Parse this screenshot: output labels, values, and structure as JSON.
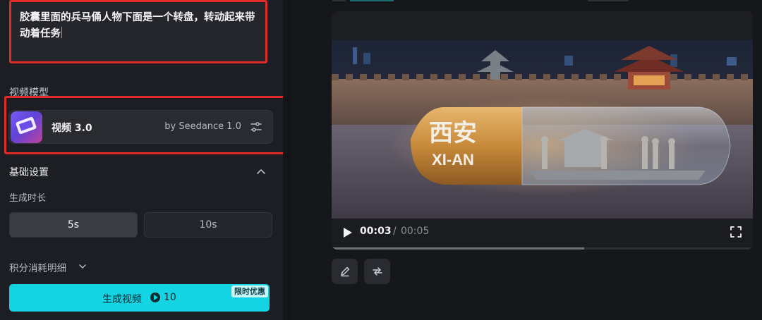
{
  "prompt": {
    "text": "胶囊里面的兵马俑人物下面是一个转盘，转动起来带动着任务"
  },
  "model": {
    "section_label": "视频模型",
    "name": "视频 3.0",
    "provider": "by Seedance 1.0"
  },
  "basic_settings": {
    "title": "基础设置",
    "duration_label": "生成时长",
    "options": [
      "5s",
      "10s"
    ],
    "selected": "5s"
  },
  "credits": {
    "label": "积分消耗明细"
  },
  "generate": {
    "label": "生成视频",
    "cost": "10",
    "badge": "限时优惠"
  },
  "video": {
    "capsule_text_cn": "西安",
    "capsule_text_en": "XI-AN",
    "current_time": "00:03",
    "separator": "/",
    "total_time": "00:05",
    "progress": 0.6
  },
  "icons": {
    "settings": "sliders-icon",
    "collapse": "chevron-up-icon",
    "expand": "chevron-down-icon",
    "play": "play-icon",
    "fullscreen": "fullscreen-icon",
    "edit": "pencil-icon",
    "regenerate": "repeat-icon"
  },
  "colors": {
    "accent": "#14d3e2",
    "highlight_border": "#e02a2a",
    "panel": "#1d1e23"
  }
}
